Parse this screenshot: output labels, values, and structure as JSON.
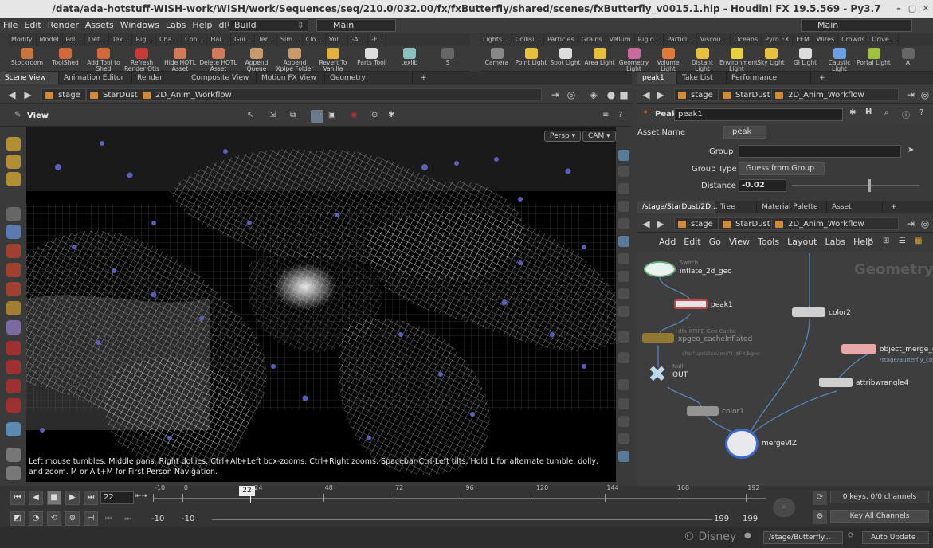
{
  "window_title": "/data/ada-hotstuff-WISH-work/WISH/work/Sequences/seq/210.0/032.00/fx/fxButterfly/shared/scenes/fxButterfly_v0015.1.hip - Houdini FX 19.5.569 - Py3.7",
  "menu": [
    "File",
    "Edit",
    "Render",
    "Assets",
    "Windows",
    "Labs",
    "Help",
    "dRig"
  ],
  "desktop_select": "Build",
  "main_select_left": "Main",
  "main_select_right": "Main",
  "shelf_tabs_left": [
    "Modify",
    "Model",
    "Pol...",
    "Def...",
    "Tex...",
    "Rig...",
    "Cha...",
    "Con...",
    "Hai...",
    "Gui...",
    "Ter...",
    "Sim...",
    "Clo...",
    "Vol...",
    "-A...",
    "-F..."
  ],
  "shelf_tabs_right": [
    "Lights...",
    "Collisi...",
    "Particles",
    "Grains",
    "Vellum",
    "Rigid...",
    "Particl...",
    "Viscou...",
    "Oceans",
    "Pyro FX",
    "FEM",
    "Wires",
    "Crowds",
    "Drive..."
  ],
  "tools_left": [
    {
      "label": "Stockroom",
      "color": "#c8743a"
    },
    {
      "label": "ToolShed",
      "color": "#d06a3a"
    },
    {
      "label": "Add Tool to Shed",
      "color": "#d06a3a"
    },
    {
      "label": "Refresh Render Otls",
      "color": "#c83a3a"
    },
    {
      "label": "Hide HOTL Asset",
      "color": "#d07a5a"
    },
    {
      "label": "Delete HOTL Asset",
      "color": "#d07a5a"
    },
    {
      "label": "Append Queue Folder",
      "color": "#c89a6a"
    },
    {
      "label": "Append Xpipe Folder",
      "color": "#c89a6a"
    },
    {
      "label": "Revert To Vanilla",
      "color": "#e0b040"
    },
    {
      "label": "Parts Tool",
      "color": "#dddddd"
    },
    {
      "label": "texlib",
      "color": "#8ac0c0"
    },
    {
      "label": "S",
      "color": "#666666"
    }
  ],
  "tools_right": [
    {
      "label": "Camera",
      "color": "#888888"
    },
    {
      "label": "Point Light",
      "color": "#e8c040"
    },
    {
      "label": "Spot Light",
      "color": "#dddddd"
    },
    {
      "label": "Area Light",
      "color": "#e8c040"
    },
    {
      "label": "Geometry Light",
      "color": "#c86a9a"
    },
    {
      "label": "Volume Light",
      "color": "#e07a3a"
    },
    {
      "label": "Distant Light",
      "color": "#e8c040"
    },
    {
      "label": "Environment Light",
      "color": "#e8d040"
    },
    {
      "label": "Sky Light",
      "color": "#e8c040"
    },
    {
      "label": "GI Light",
      "color": "#dddddd"
    },
    {
      "label": "Caustic Light",
      "color": "#6aa0e0"
    },
    {
      "label": "Portal Light",
      "color": "#a0c040"
    },
    {
      "label": "A",
      "color": "#666666"
    }
  ],
  "left_tabs": [
    "Scene View",
    "Animation Editor",
    "Render View",
    "Composite View",
    "Motion FX View",
    "Geometry Spreadsheet"
  ],
  "right_top_tabs": [
    "peak1",
    "Take List",
    "Performance Monitor"
  ],
  "right_mid_tabs": [
    "/stage/StarDust/2D...",
    "Tree View",
    "Material Palette",
    "Asset Browser"
  ],
  "crumbs": [
    "stage",
    "StarDust",
    "2D_Anim_Workflow"
  ],
  "view_label": "View",
  "persp": "Persp",
  "cam": "CAM",
  "viewport_help": "Left mouse tumbles. Middle pans. Right dollies. Ctrl+Alt+Left box-zooms. Ctrl+Right zooms. Spacebar-Ctrl-Left tilts. Hold L for alternate tumble, dolly, and zoom.    M or Alt+M for First Person Navigation.",
  "parm": {
    "node_type": "Peak",
    "node_name": "peak1",
    "asset_name_label": "Asset Name",
    "asset_name_value": "peak",
    "group_label": "Group",
    "group_value": "",
    "group_type_label": "Group Type",
    "group_type_value": "Guess from Group",
    "distance_label": "Distance",
    "distance_value": "-0.02",
    "distance_slider": 0.6
  },
  "network_menu": [
    "Add",
    "Edit",
    "Go",
    "View",
    "Tools",
    "Layout",
    "Labs",
    "Help"
  ],
  "network_watermark": "Geometry",
  "nodes": {
    "inflate_sub": "Switch",
    "inflate": "inflate_2d_geo",
    "peak": "peak1",
    "color2": "color2",
    "cache_sub": "dfx XPIPE Geo Cache",
    "cache": "xpgeo_cacheInflated",
    "cache_expr": "chs(\"updatename\")  .$F4.bgeo",
    "out_sub": "Null",
    "out": "OUT",
    "obj_merge": "object_merge_ca",
    "obj_merge_path": "/stage/Butterfly_col",
    "wrangle": "attribwrangle4",
    "color1": "color1",
    "merge": "mergeVIZ"
  },
  "timeline": {
    "current_frame": "22",
    "frame_marker": "22",
    "ticks": [
      "-10",
      "0",
      "24",
      "48",
      "72",
      "96",
      "120",
      "144",
      "168",
      "192"
    ],
    "start": "-10",
    "start2": "-10",
    "end": "199",
    "end2": "199",
    "keys_info": "0 keys, 0/0 channels",
    "key_all": "Key All Channels"
  },
  "status": {
    "copyright": "© Disney",
    "path": "/stage/Butterfly...",
    "auto_update": "Auto Update"
  }
}
